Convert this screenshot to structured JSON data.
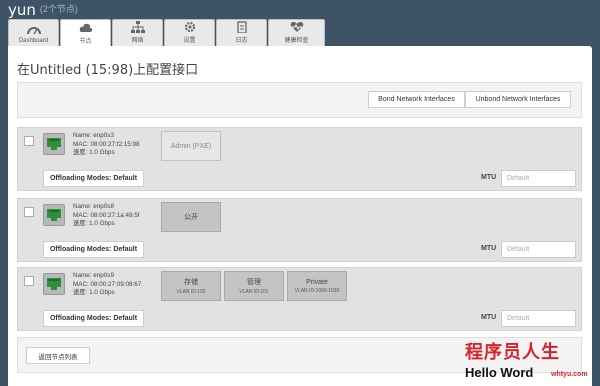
{
  "env": {
    "name": "yun",
    "count": "(2个节点)"
  },
  "tabs": [
    {
      "label": "Dashboard",
      "icon": "speedometer-icon",
      "active": false
    },
    {
      "label": "节点",
      "icon": "cloud-icon",
      "active": true
    },
    {
      "label": "网络",
      "icon": "network-icon",
      "active": false
    },
    {
      "label": "设置",
      "icon": "gear-icon",
      "active": false
    },
    {
      "label": "日志",
      "icon": "clipboard-icon",
      "active": false
    },
    {
      "label": "健康检查",
      "icon": "heartbeat-icon",
      "active": false
    }
  ],
  "page_title": "在Untitled (15:98)上配置接口",
  "bond_bar": {
    "bond_label": "Bond Network Interfaces",
    "unbond_label": "Unbond Network Interfaces"
  },
  "interfaces": [
    {
      "name": "Name: enp0s3",
      "mac": "MAC: 08:00:27:f2:15:98",
      "speed": "速度: 1.0 Gbps",
      "networks": [
        {
          "label": "Admin (PXE)",
          "vlan": ""
        }
      ],
      "offload_label": "Offloading Modes: Default",
      "mtu_label": "MTU",
      "mtu_placeholder": "Default"
    },
    {
      "name": "Name: enp0s8",
      "mac": "MAC: 08:00:27:1a:49:5f",
      "speed": "速度: 1.0 Gbps",
      "networks": [
        {
          "label": "公开",
          "vlan": ""
        }
      ],
      "offload_label": "Offloading Modes: Default",
      "mtu_label": "MTU",
      "mtu_placeholder": "Default"
    },
    {
      "name": "Name: enp0s9",
      "mac": "MAC: 08:00:27:09:08:67",
      "speed": "速度: 1.0 Gbps",
      "networks": [
        {
          "label": "存储",
          "vlan": "VLAN ID:102"
        },
        {
          "label": "管理",
          "vlan": "VLAN ID:101"
        },
        {
          "label": "Private",
          "vlan": "VLAN ID:1000-1030"
        }
      ],
      "offload_label": "Offloading Modes: Default",
      "mtu_label": "MTU",
      "mtu_placeholder": "Default"
    }
  ],
  "footer": {
    "back_label": "返回节点列表"
  },
  "watermark": {
    "top": "程序员人生",
    "bottom": "Hello Word",
    "domain": "whtyu.com"
  },
  "colors": {
    "header_bg": "#3e5366",
    "port_green": "#2f8f3a",
    "watermark_red": "#d8232a"
  }
}
